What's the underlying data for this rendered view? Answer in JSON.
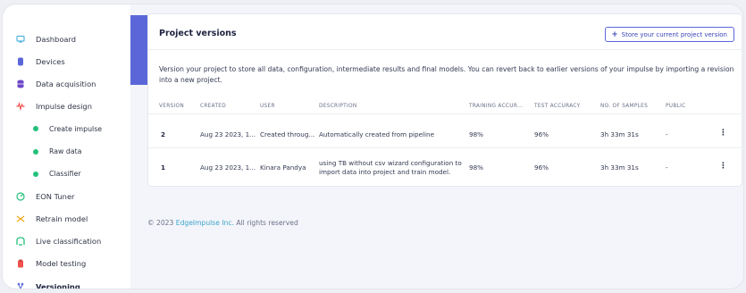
{
  "sidebar": {
    "items": [
      {
        "label": "Dashboard",
        "icon": "monitor-icon",
        "color": "#4fb3e0",
        "sub": false
      },
      {
        "label": "Devices",
        "icon": "device-icon",
        "color": "#5b67d8",
        "sub": false
      },
      {
        "label": "Data acquisition",
        "icon": "database-icon",
        "color": "#6b47c8",
        "sub": false
      },
      {
        "label": "Impulse design",
        "icon": "pulse-icon",
        "color": "#f0524d",
        "sub": false
      },
      {
        "label": "Create impulse",
        "icon": "dot-icon",
        "color": "#23c07a",
        "sub": true
      },
      {
        "label": "Raw data",
        "icon": "dot-icon",
        "color": "#23c07a",
        "sub": true
      },
      {
        "label": "Classifier",
        "icon": "dot-icon",
        "color": "#23c07a",
        "sub": true
      },
      {
        "label": "EON Tuner",
        "icon": "tuner-icon",
        "color": "#23c07a",
        "sub": false
      },
      {
        "label": "Retrain model",
        "icon": "shuffle-icon",
        "color": "#f0a81c",
        "sub": false
      },
      {
        "label": "Live classification",
        "icon": "live-icon",
        "color": "#23c07a",
        "sub": false
      },
      {
        "label": "Model testing",
        "icon": "clipboard-icon",
        "color": "#f0524d",
        "sub": false
      },
      {
        "label": "Versioning",
        "icon": "branch-icon",
        "color": "#5b67d8",
        "sub": false,
        "active": true
      }
    ]
  },
  "card": {
    "title": "Project versions",
    "store_button": "Store your current project version",
    "store_plus": "+",
    "description": "Version your project to store all data, configuration, intermediate results and final models. You can revert back to earlier versions of your impulse by importing a revision into a new project."
  },
  "table": {
    "headers": [
      "VERSION",
      "CREATED",
      "USER",
      "DESCRIPTION",
      "TRAINING ACCUR...",
      "TEST ACCURACY",
      "NO. OF SAMPLES",
      "PUBLIC"
    ],
    "rows": [
      {
        "version": "2",
        "created": "Aug 23 2023, 1...",
        "user": "Created throug...",
        "description": "Automatically created from pipeline",
        "training": "98%",
        "test": "96%",
        "samples": "3h 33m 31s",
        "public": "-",
        "menu": "⋮"
      },
      {
        "version": "1",
        "created": "Aug 23 2023, 1...",
        "user": "Kinara Pandya",
        "description": "using TB without csv wizard configuration to import data into project and train model.",
        "training": "98%",
        "test": "96%",
        "samples": "3h 33m 31s",
        "public": "-",
        "menu": "⋮"
      }
    ]
  },
  "footer": {
    "prefix": "© 2023",
    "link": "EdgeImpulse Inc.",
    "suffix": "All rights reserved"
  },
  "colors": {
    "accent": "#5b67d8",
    "link": "#3aa4c9",
    "dot": "#23c07a"
  }
}
